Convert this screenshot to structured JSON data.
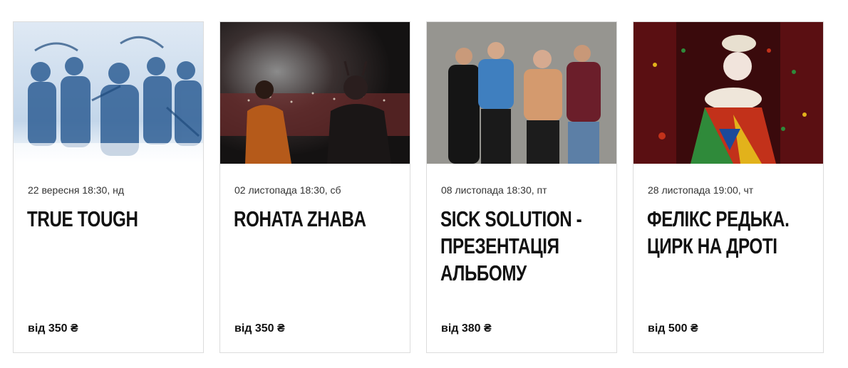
{
  "events": [
    {
      "date": "22 вересня 18:30, нд",
      "title": "TRUE TOUGH",
      "price": "від 350 ₴",
      "image": "band-illustration-blue"
    },
    {
      "date": "02 листопада 18:30, сб",
      "title": "ROHATA ZHABA",
      "price": "від 350 ₴",
      "image": "concert-crowd-photo"
    },
    {
      "date": "08 листопада 18:30, пт",
      "title": "SICK SOLUTION - ПРЕЗЕНТАЦІЯ АЛЬБОМУ",
      "price": "від 380 ₴",
      "image": "band-group-photo"
    },
    {
      "date": "28 листопада 19:00, чт",
      "title": "ФЕЛІКС РЕДЬКА. ЦИРК НА ДРОТІ",
      "price": "від 500 ₴",
      "image": "clown-portrait-photo"
    }
  ]
}
